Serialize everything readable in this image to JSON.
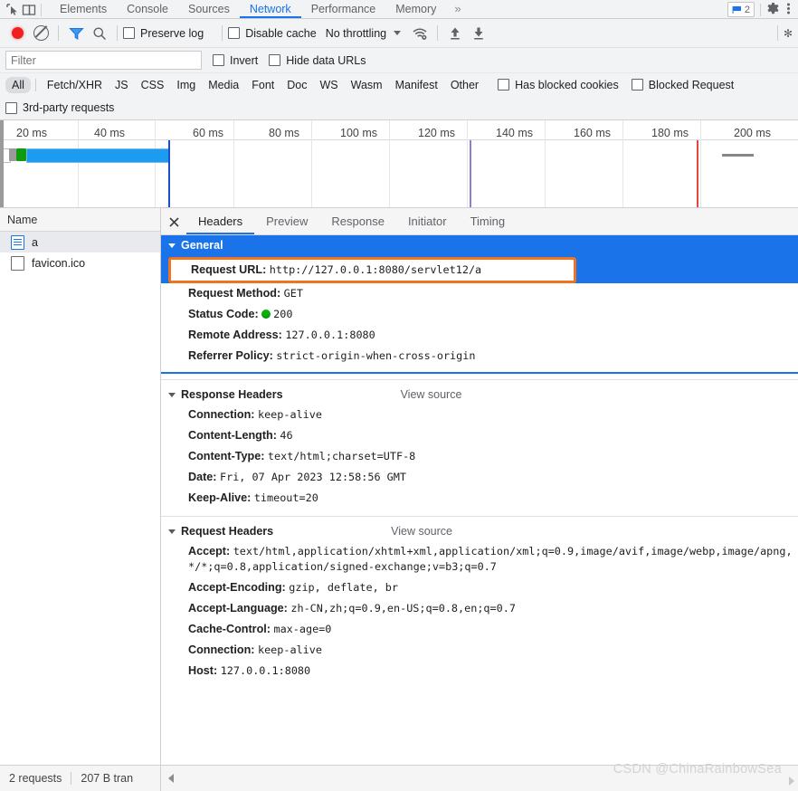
{
  "panel_tabs": {
    "items": [
      {
        "label": "Elements",
        "active": false
      },
      {
        "label": "Console",
        "active": false
      },
      {
        "label": "Sources",
        "active": false
      },
      {
        "label": "Network",
        "active": true
      },
      {
        "label": "Performance",
        "active": false
      },
      {
        "label": "Memory",
        "active": false
      }
    ],
    "more_label": "»",
    "issues_count": "2",
    "dock_icon": "inspect-icon",
    "device_icon": "device-toolbar-icon",
    "settings_icon": "gear-icon",
    "menu_icon": "kebab-menu-icon"
  },
  "toolbar": {
    "record_label": "record-button",
    "clear_label": "clear-button",
    "filter_icon_label": "filter-icon",
    "search_icon_label": "search-icon",
    "preserve_log": "Preserve log",
    "disable_cache": "Disable cache",
    "throttling": "No throttling",
    "wifi_icon": "network-conditions-icon",
    "import_icon": "import-har-icon",
    "export_icon": "export-har-icon"
  },
  "filter": {
    "placeholder": "Filter",
    "value": "",
    "invert": "Invert",
    "hide_data_urls": "Hide data URLs"
  },
  "types": {
    "items": [
      "All",
      "Fetch/XHR",
      "JS",
      "CSS",
      "Img",
      "Media",
      "Font",
      "Doc",
      "WS",
      "Wasm",
      "Manifest",
      "Other"
    ],
    "selected": "All",
    "has_blocked_cookies": "Has blocked cookies",
    "blocked_requests": "Blocked Request",
    "third_party": "3rd-party requests"
  },
  "overview": {
    "ticks": [
      "20 ms",
      "40 ms",
      "60 ms",
      "80 ms",
      "100 ms",
      "120 ms",
      "140 ms",
      "160 ms",
      "180 ms",
      "200 ms"
    ]
  },
  "request_list": {
    "column_header": "Name",
    "rows": [
      {
        "name": "a",
        "icon": "document-icon",
        "selected": true
      },
      {
        "name": "favicon.ico",
        "icon": "generic-file-icon",
        "selected": false
      }
    ]
  },
  "detail": {
    "close_icon": "close-icon",
    "tabs": [
      {
        "label": "Headers",
        "active": true
      },
      {
        "label": "Preview",
        "active": false
      },
      {
        "label": "Response",
        "active": false
      },
      {
        "label": "Initiator",
        "active": false
      },
      {
        "label": "Timing",
        "active": false
      }
    ],
    "general": {
      "title": "General",
      "rows": [
        {
          "key": "Request URL:",
          "value": "http://127.0.0.1:8080/servlet12/a",
          "highlighted": true
        },
        {
          "key": "Request Method:",
          "value": "GET",
          "highlighted": false
        },
        {
          "key": "Status Code:",
          "value": "200",
          "status_dot": true,
          "highlighted": false
        },
        {
          "key": "Remote Address:",
          "value": "127.0.0.1:8080",
          "highlighted": false
        },
        {
          "key": "Referrer Policy:",
          "value": "strict-origin-when-cross-origin",
          "highlighted": false
        }
      ]
    },
    "response_headers": {
      "title": "Response Headers",
      "view_source": "View source",
      "rows": [
        {
          "key": "Connection:",
          "value": "keep-alive"
        },
        {
          "key": "Content-Length:",
          "value": "46"
        },
        {
          "key": "Content-Type:",
          "value": "text/html;charset=UTF-8"
        },
        {
          "key": "Date:",
          "value": "Fri, 07 Apr 2023 12:58:56 GMT"
        },
        {
          "key": "Keep-Alive:",
          "value": "timeout=20"
        }
      ]
    },
    "request_headers": {
      "title": "Request Headers",
      "view_source": "View source",
      "rows": [
        {
          "key": "Accept:",
          "value": "text/html,application/xhtml+xml,application/xml;q=0.9,image/avif,image/webp,image/apng,*/*;q=0.8,application/signed-exchange;v=b3;q=0.7"
        },
        {
          "key": "Accept-Encoding:",
          "value": "gzip, deflate, br"
        },
        {
          "key": "Accept-Language:",
          "value": "zh-CN,zh;q=0.9,en-US;q=0.8,en;q=0.7"
        },
        {
          "key": "Cache-Control:",
          "value": "max-age=0"
        },
        {
          "key": "Connection:",
          "value": "keep-alive"
        },
        {
          "key": "Host:",
          "value": "127.0.0.1:8080"
        }
      ]
    }
  },
  "statusbar": {
    "requests": "2 requests",
    "transferred": "207 B tran"
  },
  "watermark": "CSDN @ChinaRainbowSea",
  "colors": {
    "accent": "#1a73e8",
    "highlight": "#ef7320",
    "record": "#ee2020",
    "status_ok": "#0ab20a",
    "toolbar_bg": "#f1f3f4"
  }
}
